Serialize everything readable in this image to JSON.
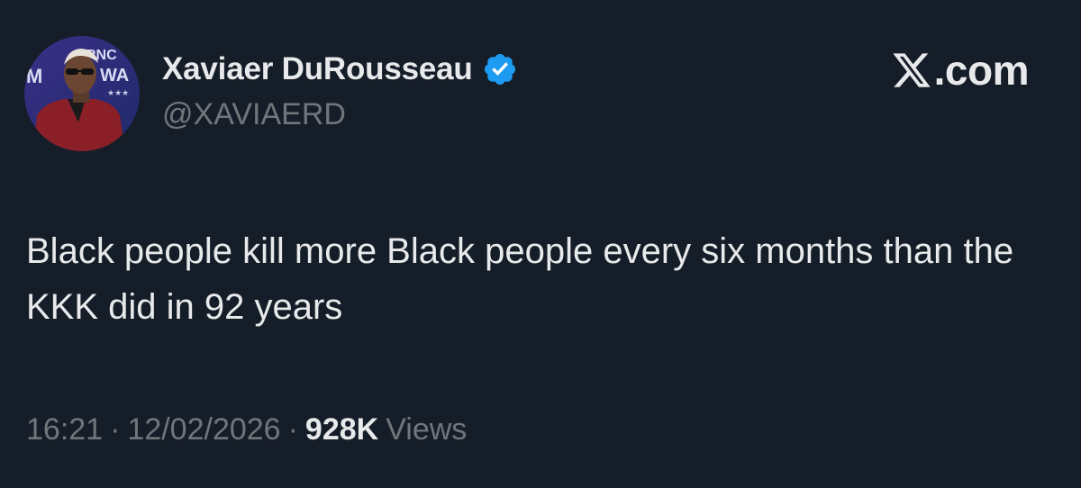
{
  "author": {
    "display_name": "Xaviaer DuRousseau",
    "handle": "@XAVIAERD",
    "verified": true,
    "avatar_backdrop_text": [
      "RNC",
      "M",
      "WA",
      "★★★"
    ]
  },
  "brand": {
    "logo_icon": "x-logo-icon",
    "text": ".com"
  },
  "tweet": {
    "text": "Black people kill more Black people every six months than the KKK did in 92 years"
  },
  "meta": {
    "time": "16:21",
    "separator": "·",
    "date": "12/02/2026",
    "views_count": "928K",
    "views_label": "Views"
  },
  "colors": {
    "background": "#151d28",
    "primary_text": "#e7e9ea",
    "secondary_text": "#71767b",
    "verified_badge": "#1d9bf0"
  }
}
